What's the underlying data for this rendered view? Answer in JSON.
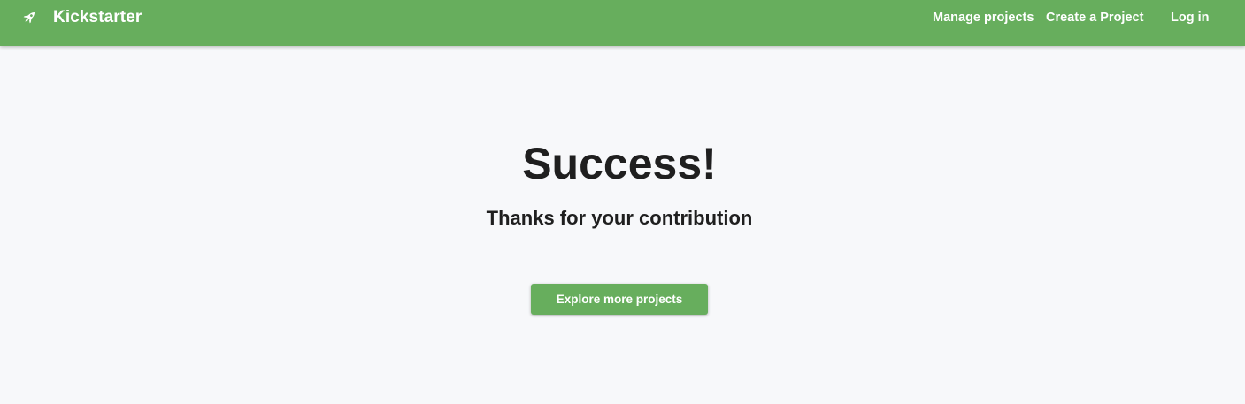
{
  "navbar": {
    "brand_name": "Kickstarter",
    "brand_icon": "rocket-icon",
    "links": [
      {
        "label": "Manage projects"
      },
      {
        "label": "Create a Project"
      },
      {
        "label": "Log in"
      }
    ]
  },
  "main": {
    "title": "Success!",
    "subtitle": "Thanks for your contribution",
    "cta_label": "Explore more projects"
  },
  "colors": {
    "brand_green": "#67ae5d",
    "background": "#f7f8fa",
    "text_dark": "#1f1f1f"
  }
}
